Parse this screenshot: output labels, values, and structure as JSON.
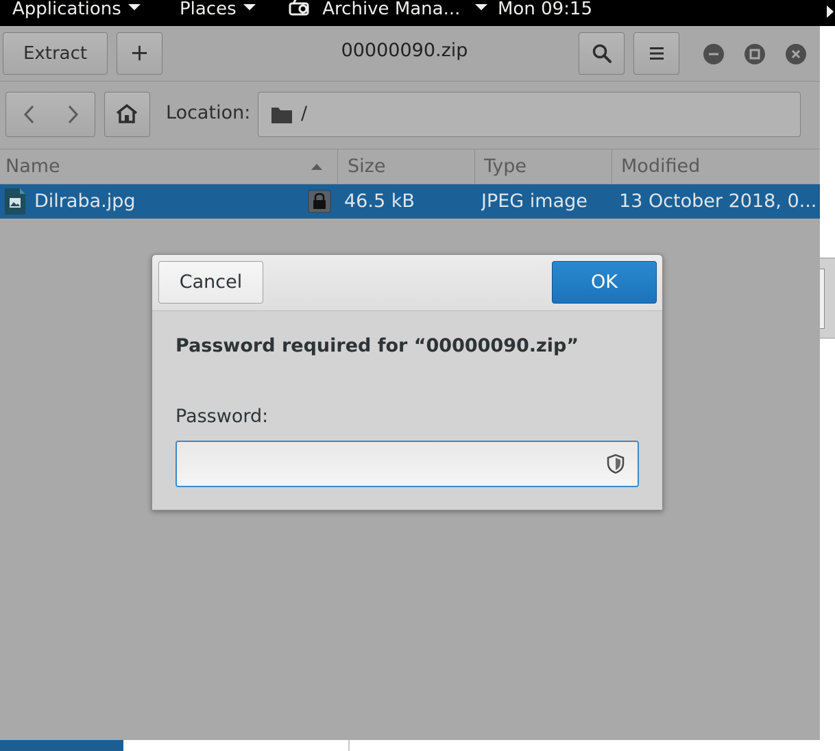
{
  "topbar": {
    "applications": "Applications",
    "places": "Places",
    "active_app": "Archive Mana...",
    "clock": "Mon 09:15"
  },
  "headerbar": {
    "extract_label": "Extract",
    "add_label": "+",
    "title": "00000090.zip"
  },
  "location": {
    "label": "Location:",
    "path": "/"
  },
  "columns": {
    "name": "Name",
    "size": "Size",
    "type": "Type",
    "modified": "Modified"
  },
  "files": [
    {
      "name": "Dilraba.jpg",
      "size": "46.5 kB",
      "type": "JPEG image",
      "modified": "13 October 2018, 0...",
      "encrypted": true
    }
  ],
  "dialog": {
    "cancel_label": "Cancel",
    "ok_label": "OK",
    "message": "Password required for “00000090.zip”",
    "password_label": "Password:",
    "password_value": ""
  },
  "colors": {
    "selection": "#1b6096",
    "ok_button": "#1c74bb",
    "window_bg": "#a9a9a9"
  }
}
